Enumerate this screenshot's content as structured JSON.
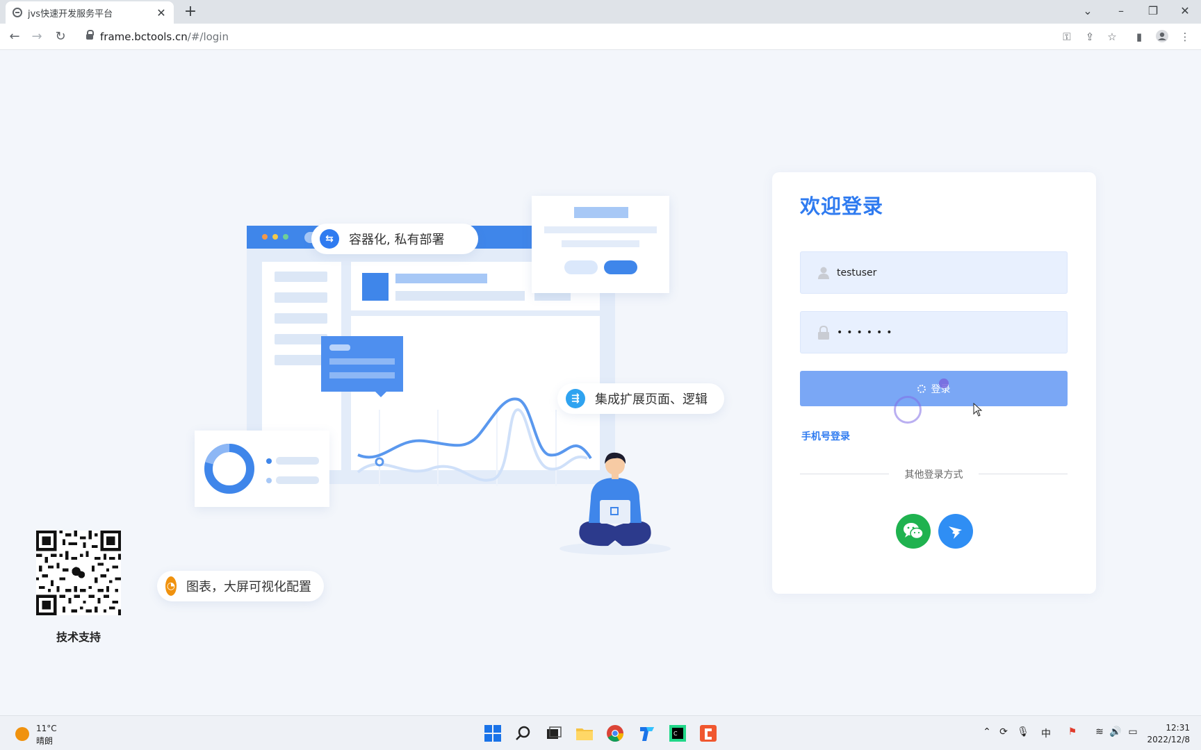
{
  "browser": {
    "tab_title": "jvs快速开发服务平台",
    "tab_close": "✕",
    "new_tab": "+",
    "url_host": "frame.bctools.cn",
    "url_path": "/#/login"
  },
  "illustration": {
    "pill_container": "容器化, 私有部署",
    "pill_extend": "集成扩展页面、逻辑",
    "pill_chart": "图表，大屏可视化配置"
  },
  "qr": {
    "label": "技术支持"
  },
  "login": {
    "title": "欢迎登录",
    "username_value": "testuser",
    "password_mask": "••••••",
    "button_label": "登录",
    "phone_login": "手机号登录",
    "other_methods": "其他登录方式"
  },
  "taskbar": {
    "temperature": "11°C",
    "weather": "晴朗",
    "ime": "中",
    "time": "12:31",
    "date": "2022/12/8"
  },
  "colors": {
    "accent": "#2f7bf0",
    "button_loading": "#7aa7f5",
    "input_bg": "#e8f0fe",
    "wechat": "#1fb24f",
    "dingtalk": "#2f8ef4"
  }
}
